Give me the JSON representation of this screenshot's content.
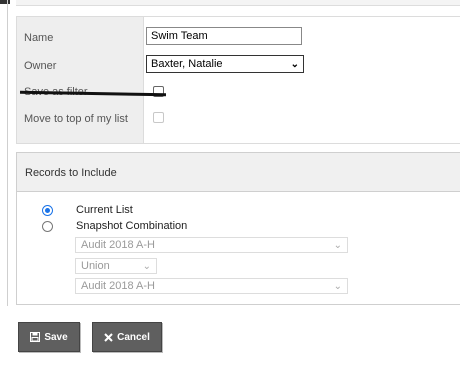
{
  "form": {
    "name_label": "Name",
    "name_value": "Swim Team",
    "owner_label": "Owner",
    "owner_value": "Baxter, Natalie",
    "save_filter_label": "Save as filter",
    "move_top_label": "Move to top of my list"
  },
  "records": {
    "title": "Records to Include",
    "option_current": "Current List",
    "option_snapshot": "Snapshot Combination",
    "snapshot_a": "Audit 2018 A-H",
    "operator": "Union",
    "snapshot_b": "Audit 2018 A-H"
  },
  "buttons": {
    "save_label": "Save",
    "cancel_label": "Cancel"
  },
  "colors": {
    "accent": "#1a73e8",
    "button_bg": "#5f5f5f"
  },
  "icons": {
    "save": "floppy-disk-icon",
    "cancel": "x-icon",
    "dropdown": "chevron-down-icon"
  }
}
